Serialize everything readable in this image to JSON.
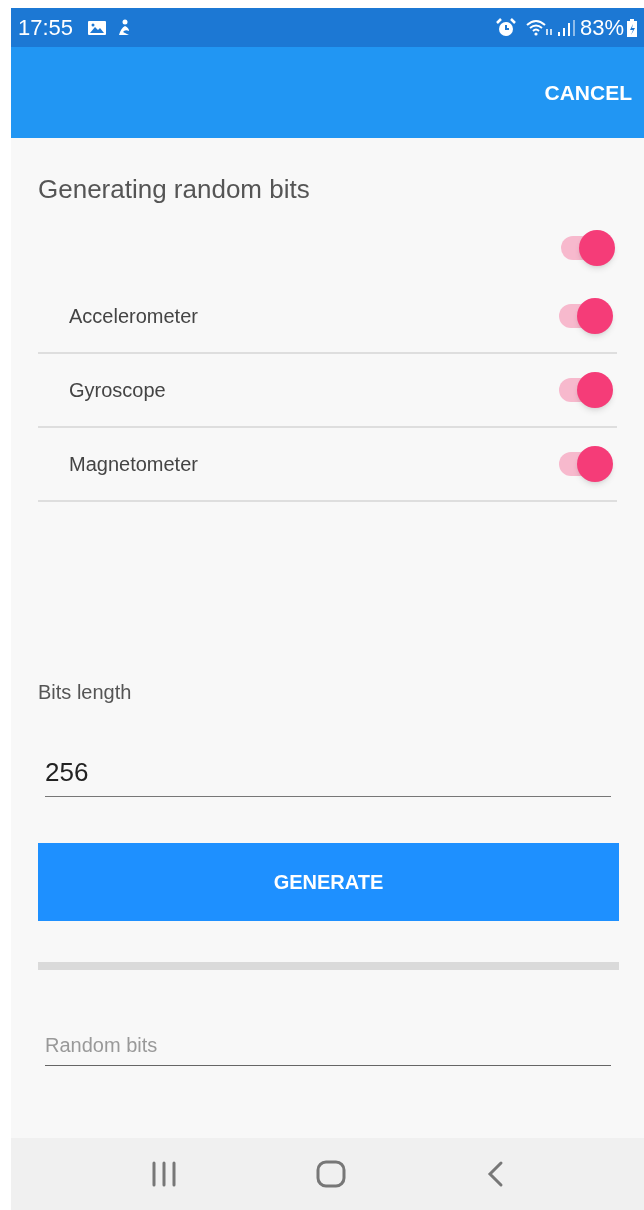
{
  "status_bar": {
    "time": "17:55",
    "battery": "83%"
  },
  "app_bar": {
    "action": "CANCEL"
  },
  "title": "Generating random bits",
  "master_switch": {
    "on": true
  },
  "sensors": [
    {
      "label": "Accelerometer",
      "on": true
    },
    {
      "label": "Gyroscope",
      "on": true
    },
    {
      "label": "Magnetometer",
      "on": true
    }
  ],
  "bits_length": {
    "label": "Bits length",
    "value": "256"
  },
  "generate_button": "GENERATE",
  "progress": {
    "level": 0
  },
  "output": {
    "placeholder": "Random bits"
  }
}
